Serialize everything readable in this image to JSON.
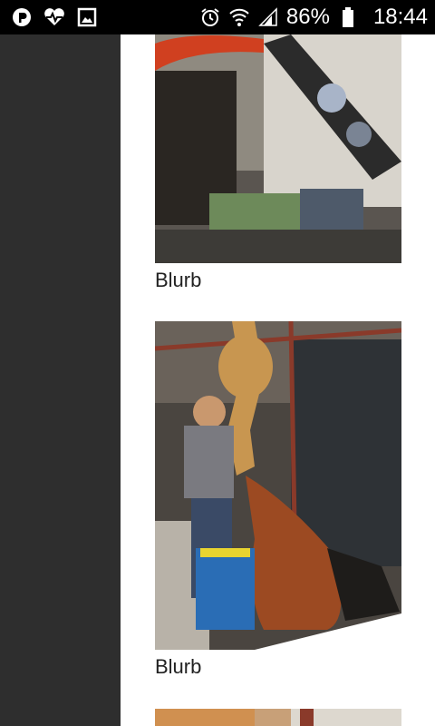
{
  "status_bar": {
    "left_icons": [
      "p-app-icon",
      "heart-rate-icon",
      "image-icon"
    ],
    "right_icons": [
      "alarm-icon",
      "wifi-icon",
      "signal-icon",
      "battery-icon"
    ],
    "battery": "86%",
    "time": "18:44"
  },
  "gallery": {
    "items": [
      {
        "caption": "Blurb",
        "image": "robot-arm-workshop"
      },
      {
        "caption": "Blurb",
        "image": "man-with-giraffe-sculpture"
      },
      {
        "caption": "",
        "image": "giraffe-partial"
      }
    ]
  },
  "colors": {
    "sidebar": "#2e2e2e",
    "status_bar": "#000000",
    "background": "#ffffff"
  }
}
